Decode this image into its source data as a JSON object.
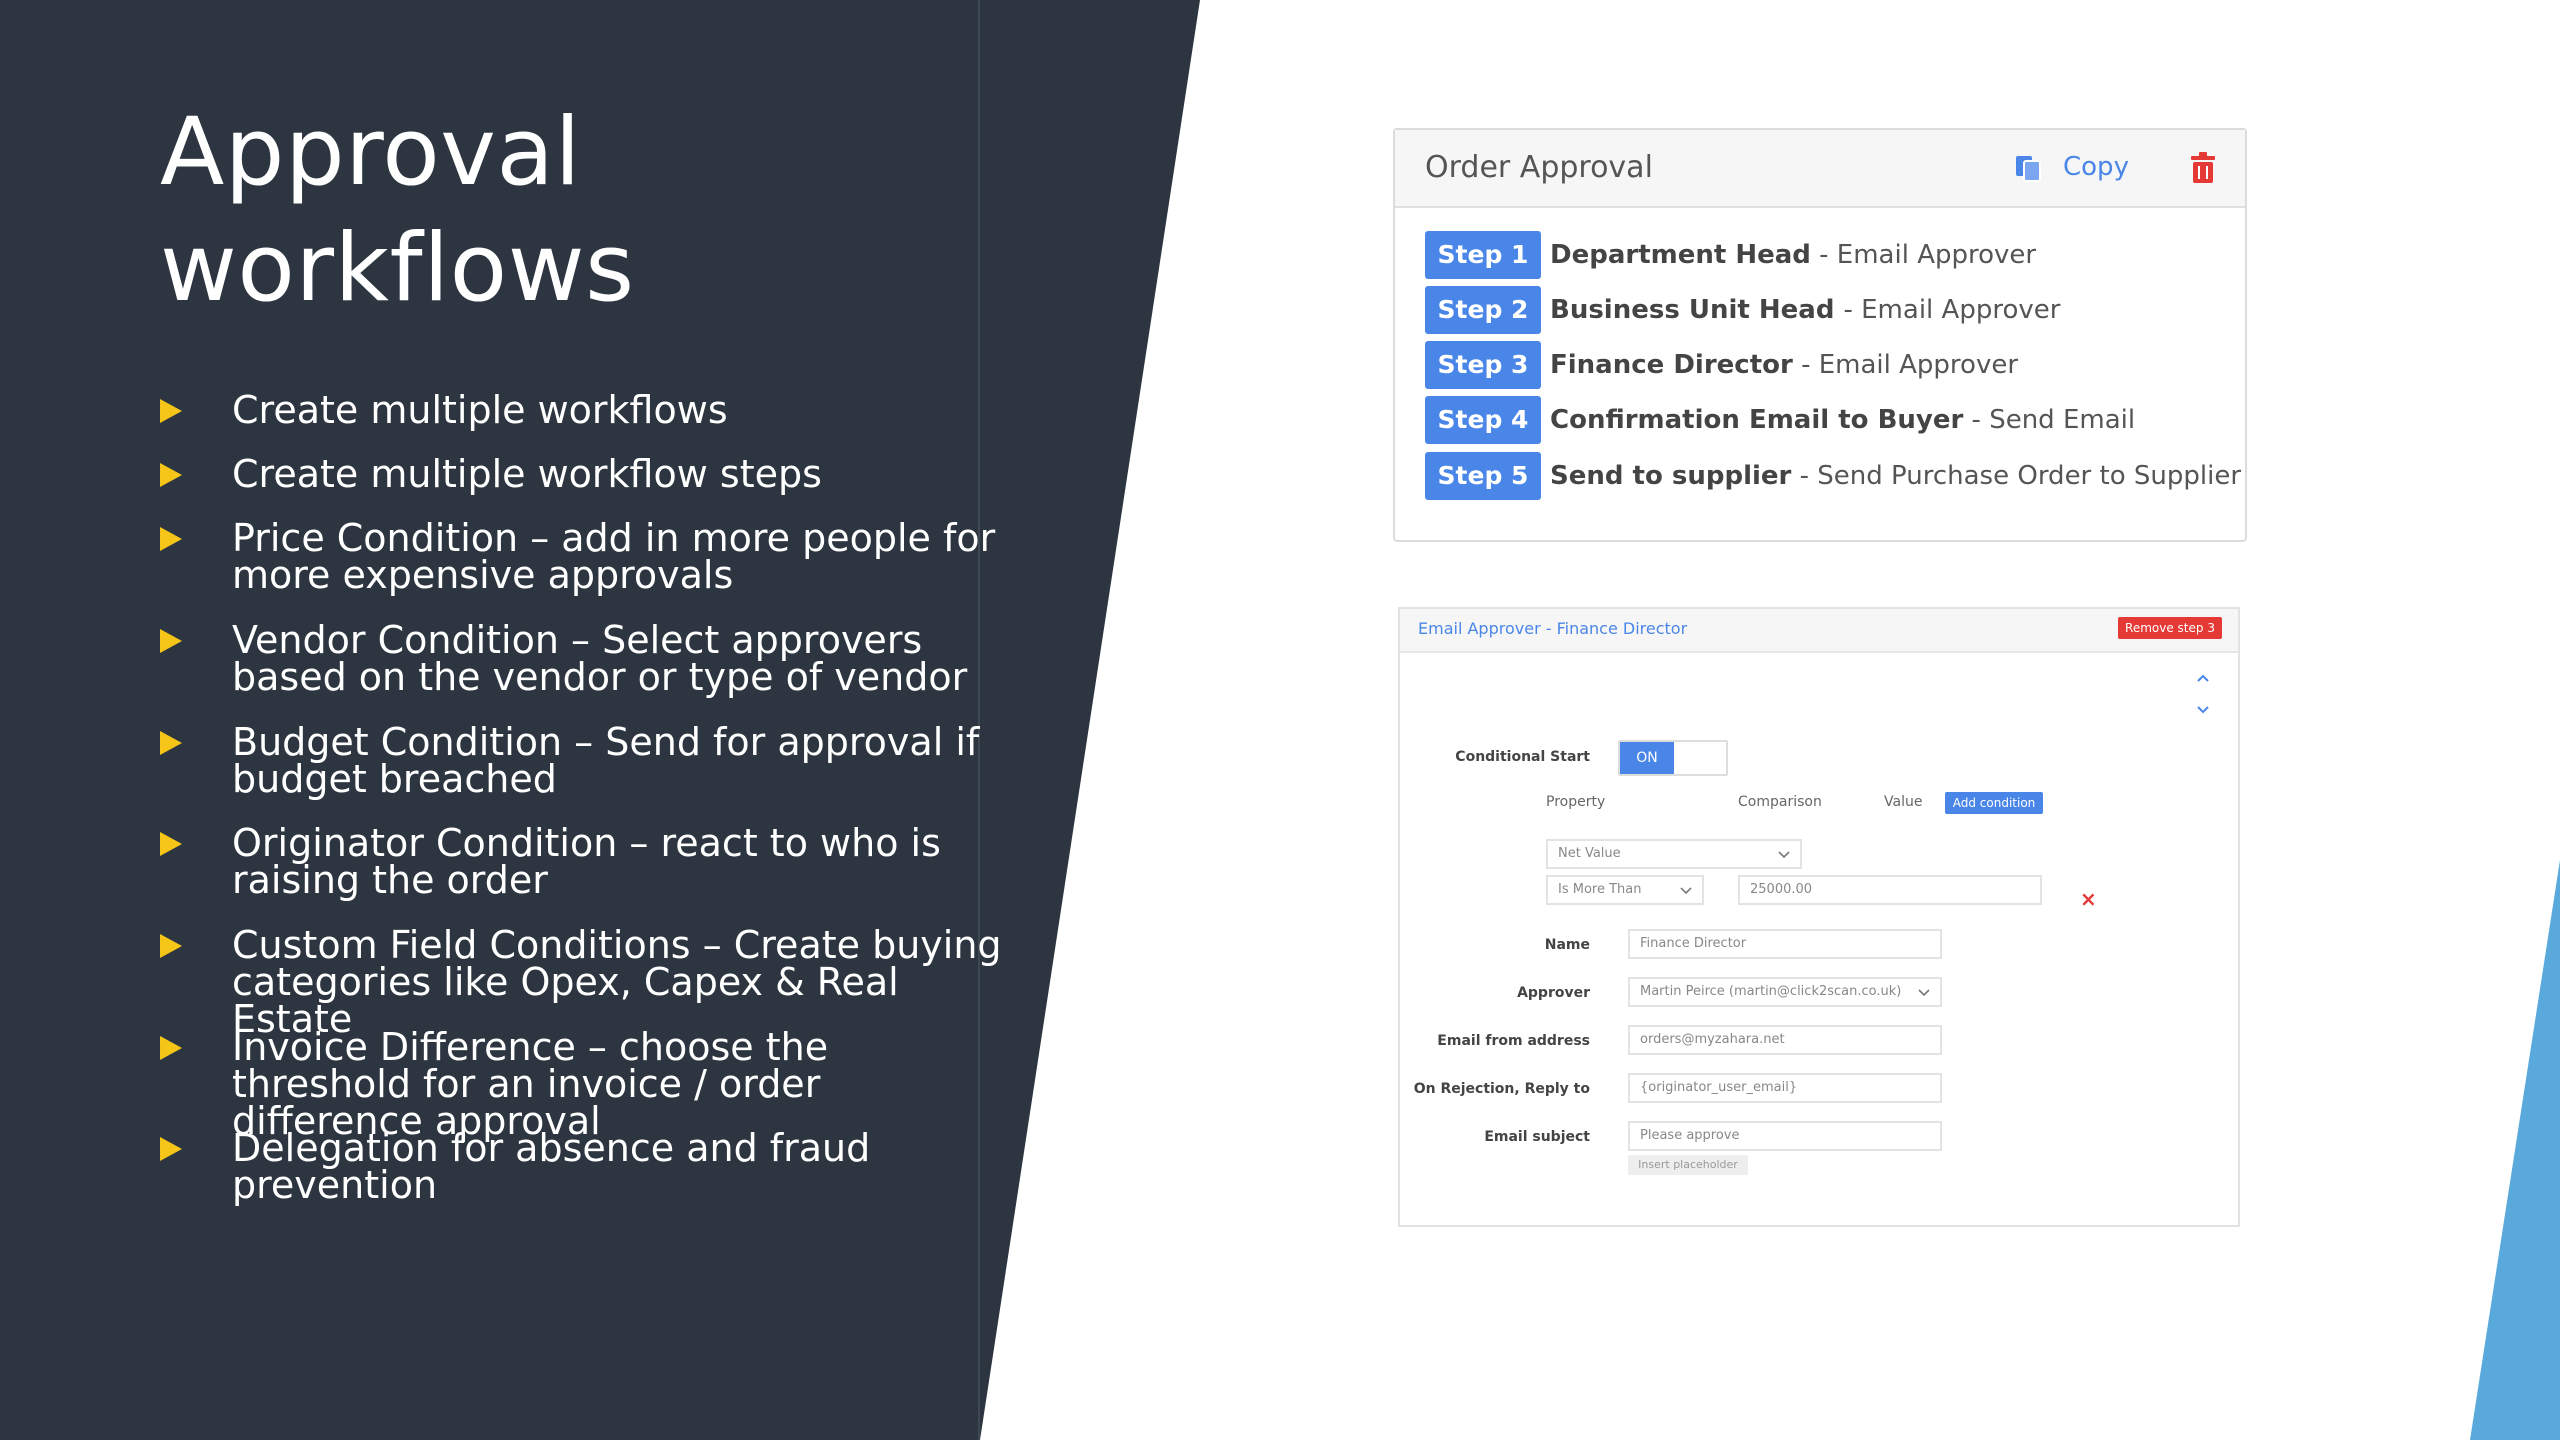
{
  "slide": {
    "title_line1": "Approval",
    "title_line2": "workflows",
    "bullets": [
      "Create multiple workflows",
      "Create multiple workflow steps",
      "Price Condition – add in more people for more expensive approvals",
      "Vendor Condition – Select approvers based on the vendor or type of vendor",
      "Budget Condition – Send for approval if budget breached",
      "Originator Condition – react to who is raising the order",
      "Custom Field Conditions – Create buying categories like Opex, Capex & Real Estate",
      "Invoice Difference – choose the threshold for an invoice / order difference approval",
      "Delegation for absence and fraud prevention"
    ],
    "colors": {
      "panel": "#2d3640",
      "bullet": "#f5c518",
      "accent": "#4a86e8",
      "edge": "#5aa9dc"
    }
  },
  "order_approval": {
    "title": "Order Approval",
    "copy_label": "Copy",
    "steps": [
      {
        "badge": "Step 1",
        "name": "Department Head",
        "detail": " - Email Approver"
      },
      {
        "badge": "Step 2",
        "name": "Business Unit Head ",
        "detail": " - Email Approver"
      },
      {
        "badge": "Step 3",
        "name": "Finance Director",
        "detail": " - Email Approver"
      },
      {
        "badge": "Step 4",
        "name": "Confirmation Email to Buyer",
        "detail": " - Send Email"
      },
      {
        "badge": "Step 5",
        "name": "Send to supplier",
        "detail": " - Send Purchase Order to Supplier"
      }
    ]
  },
  "email_approver": {
    "title": "Email Approver - Finance Director",
    "remove_label": "Remove step 3",
    "conditional_start_label": "Conditional Start",
    "toggle_label": "ON",
    "col_property": "Property",
    "col_comparison": "Comparison",
    "col_value": "Value",
    "add_condition_label": "Add condition",
    "property_value": "Net Value",
    "comparison_value": "Is More Than",
    "value_value": "25000.00",
    "remove_condition": "×",
    "name_label": "Name",
    "name_value": "Finance Director",
    "approver_label": "Approver",
    "approver_value": "Martin Peirce (martin@click2scan.co.uk)",
    "from_label": "Email from address",
    "from_value": "orders@myzahara.net",
    "rejection_label": "On Rejection, Reply to",
    "rejection_value": "{originator_user_email}",
    "subject_label": "Email subject",
    "subject_value": "Please approve",
    "insert_placeholder_label": "Insert placeholder"
  }
}
